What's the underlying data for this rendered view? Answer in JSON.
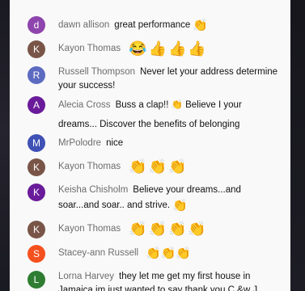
{
  "colors": {
    "purple": "#8e44ad",
    "brown": "#795548",
    "indigo": "#5c6bc0",
    "deep_purple": "#6a1b9a",
    "blue_violet": "#3f51b5",
    "orange": "#f4511e",
    "green": "#2e7d32"
  },
  "messages": [
    {
      "initial": "d",
      "author": "dawn allison",
      "text": "great performance",
      "emoji": "👏"
    },
    {
      "initial": "K",
      "author": "Kayon Thomas",
      "text": "",
      "emoji": "😂👍👍👍"
    },
    {
      "initial": "R",
      "author": "Russell Thompson",
      "text": "Never let your address determine your success!",
      "emoji": ""
    },
    {
      "initial": "A",
      "author": "Alecia Cross",
      "text": "Buss a clap!! 👏 Believe I your dreams... Discover the benefits of belonging",
      "emoji": ""
    },
    {
      "initial": "M",
      "author": "MrPolodre",
      "text": "nice",
      "emoji": ""
    },
    {
      "initial": "K",
      "author": "Kayon Thomas",
      "text": "",
      "emoji": "👏👏👏"
    },
    {
      "initial": "K",
      "author": "Keisha Chisholm",
      "text": "Believe your dreams...and soar...and soar.. and strive.",
      "emoji": "👏"
    },
    {
      "initial": "K",
      "author": "Kayon Thomas",
      "text": "",
      "emoji": "👏👏👏👏"
    },
    {
      "initial": "S",
      "author": "Stacey-ann Russell",
      "text": "",
      "emoji": "👏👏👏"
    },
    {
      "initial": "L",
      "author": "Lorna Harvey",
      "text": "they let me get my first house in Jamaica im just wanted to say thank you C &w J",
      "emoji": ""
    }
  ]
}
